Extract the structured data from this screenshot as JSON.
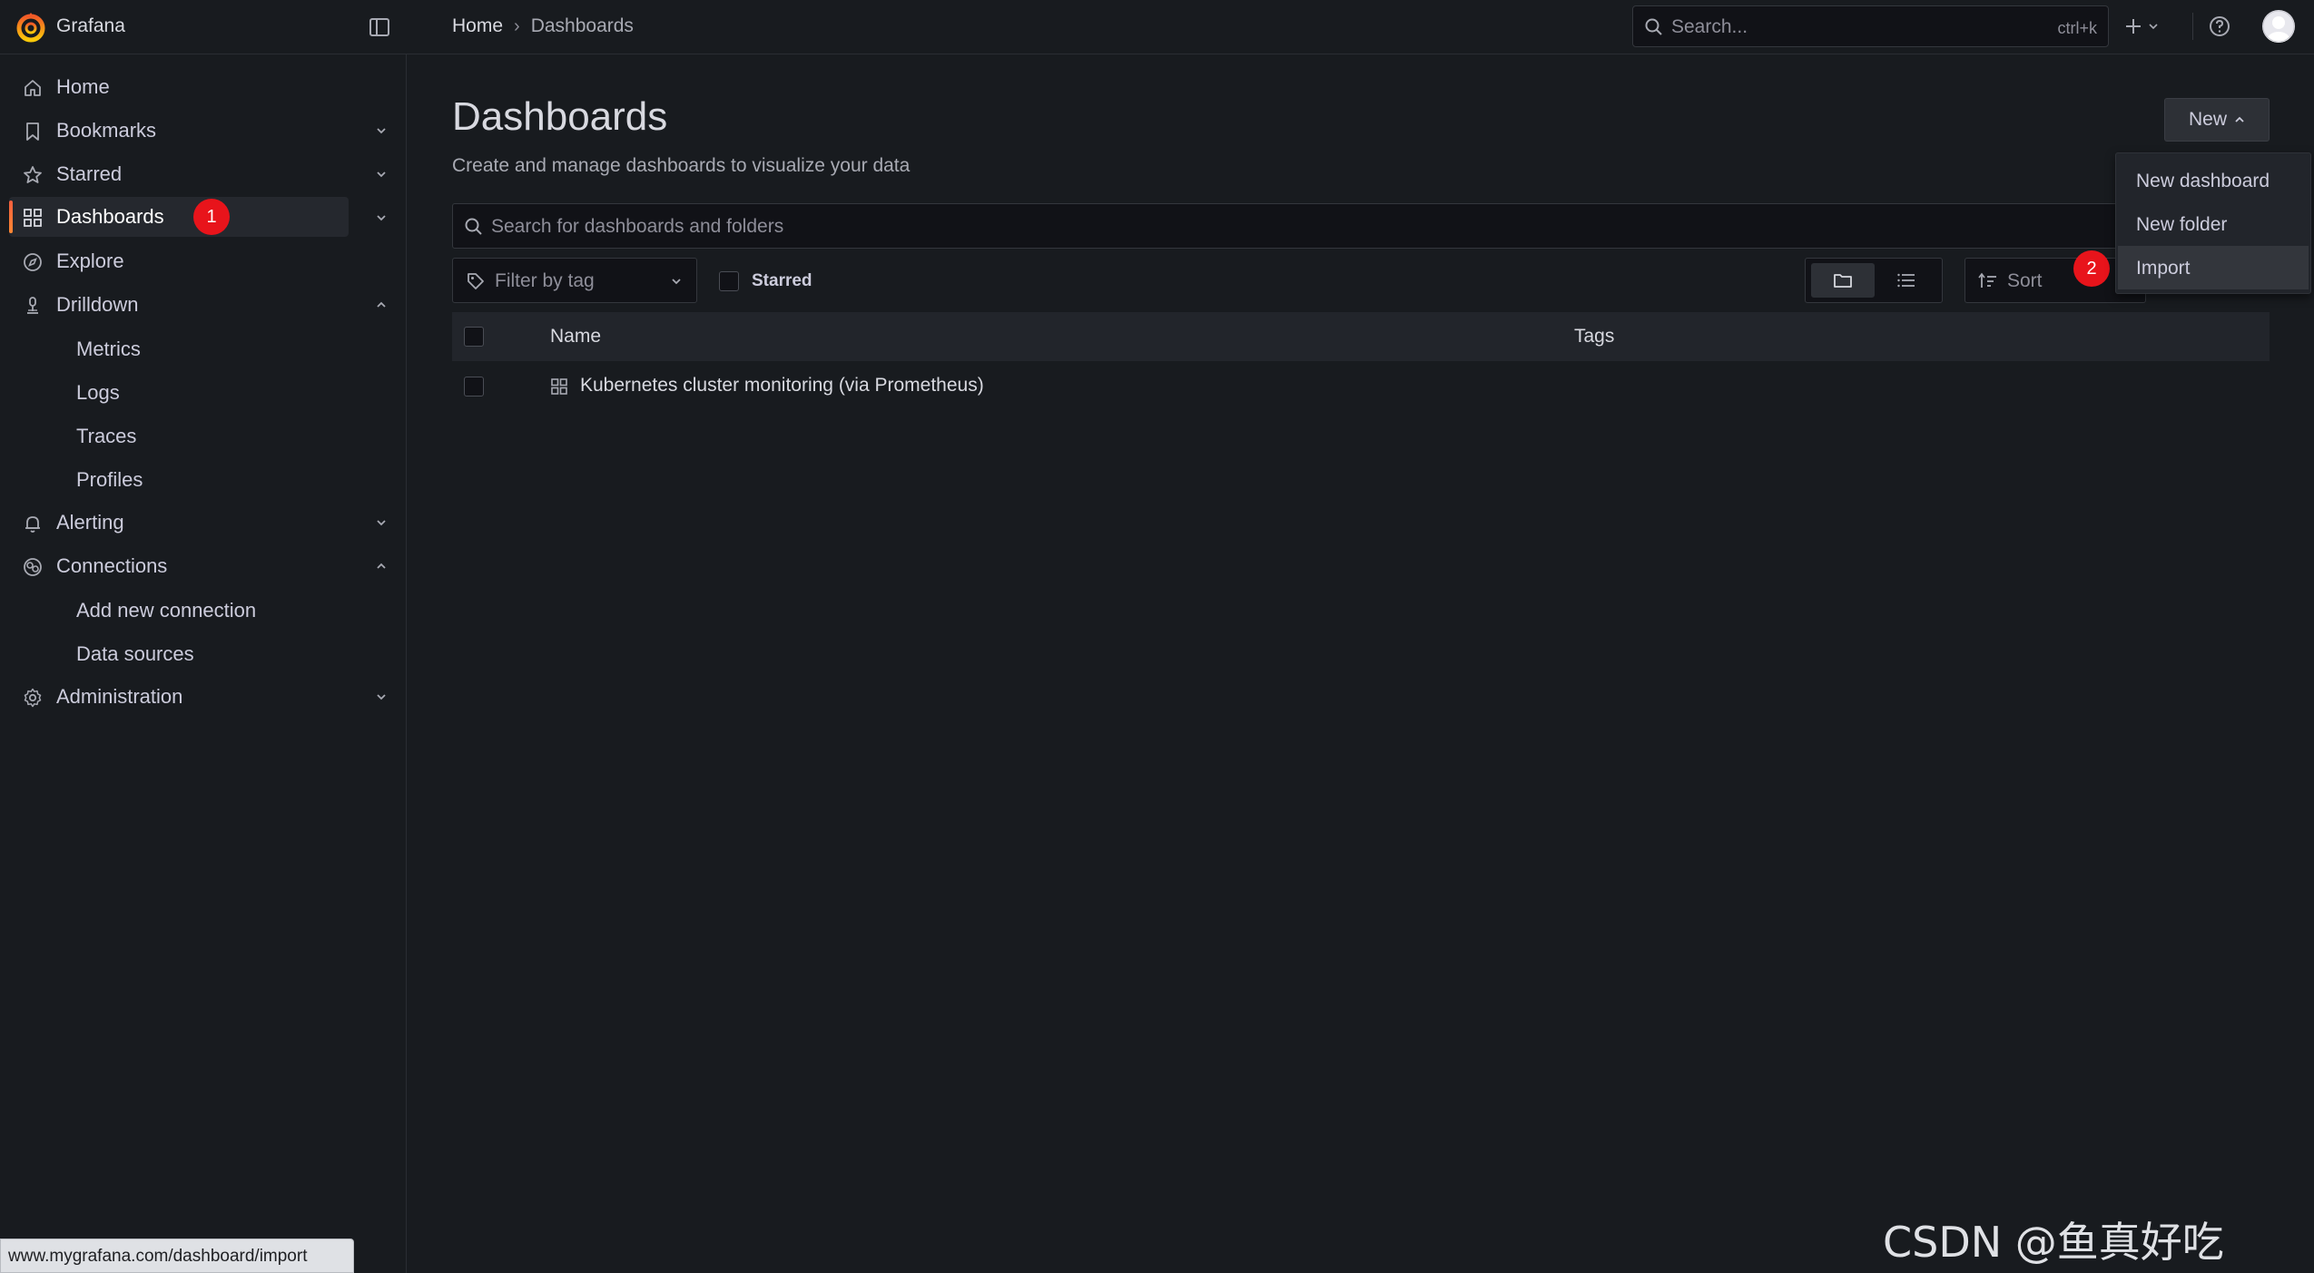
{
  "app": {
    "name": "Grafana"
  },
  "breadcrumb": {
    "home": "Home",
    "separator": "›",
    "current": "Dashboards"
  },
  "top_search": {
    "placeholder": "Search...",
    "shortcut": "ctrl+k"
  },
  "sidebar": {
    "items": [
      {
        "label": "Home",
        "icon": "home-icon"
      },
      {
        "label": "Bookmarks",
        "icon": "bookmark-icon",
        "expanded": false
      },
      {
        "label": "Starred",
        "icon": "star-icon",
        "expanded": false
      },
      {
        "label": "Dashboards",
        "icon": "apps-icon",
        "expanded": false,
        "active": true
      },
      {
        "label": "Explore",
        "icon": "compass-icon"
      },
      {
        "label": "Drilldown",
        "icon": "drilldown-icon",
        "expanded": true,
        "children": [
          "Metrics",
          "Logs",
          "Traces",
          "Profiles"
        ]
      },
      {
        "label": "Alerting",
        "icon": "bell-icon",
        "expanded": false
      },
      {
        "label": "Connections",
        "icon": "connections-icon",
        "expanded": true,
        "children": [
          "Add new connection",
          "Data sources"
        ]
      },
      {
        "label": "Administration",
        "icon": "cog-icon",
        "expanded": false
      }
    ]
  },
  "badges": {
    "first": "1",
    "second": "2"
  },
  "page": {
    "title": "Dashboards",
    "subtitle": "Create and manage dashboards to visualize your data",
    "new_button": "New"
  },
  "new_menu": {
    "items": [
      "New dashboard",
      "New folder",
      "Import"
    ],
    "highlighted": "Import"
  },
  "filters": {
    "search_placeholder": "Search for dashboards and folders",
    "tag_placeholder": "Filter by tag",
    "starred_label": "Starred",
    "sort_label": "Sort",
    "view": "folder"
  },
  "table": {
    "headers": {
      "name": "Name",
      "tags": "Tags"
    },
    "rows": [
      {
        "name": "Kubernetes cluster monitoring (via Prometheus)",
        "tags": []
      }
    ]
  },
  "status_url": "www.mygrafana.com/dashboard/import",
  "watermark": "CSDN @鱼真好吃^o^",
  "colors": {
    "background": "#181b1f",
    "accent": "#f55f3e",
    "badge": "#e8141b"
  }
}
